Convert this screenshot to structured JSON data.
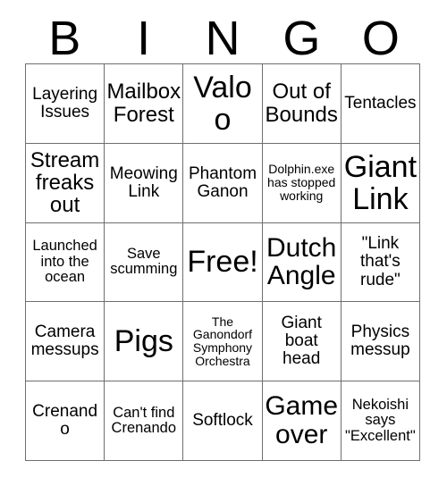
{
  "card": {
    "header_letters": [
      "B",
      "I",
      "N",
      "G",
      "O"
    ],
    "columns": 5,
    "rows": 5,
    "border_color": "#6e6e6e",
    "background_color": "#ffffff",
    "text_color": "#000000",
    "cells": [
      {
        "text": "Layering Issues",
        "size": "md",
        "free": false
      },
      {
        "text": "Mailbox Forest",
        "size": "lg",
        "free": false
      },
      {
        "text": "Valoo",
        "size": "xxl",
        "free": false
      },
      {
        "text": "Out of Bounds",
        "size": "lg",
        "free": false
      },
      {
        "text": "Tentacles",
        "size": "md",
        "free": false
      },
      {
        "text": "Stream freaks out",
        "size": "lg",
        "free": false
      },
      {
        "text": "Meowing Link",
        "size": "md",
        "free": false
      },
      {
        "text": "Phantom Ganon",
        "size": "md",
        "free": false
      },
      {
        "text": "Dolphin.exe has stopped working",
        "size": "xs",
        "free": false
      },
      {
        "text": "Giant Link",
        "size": "xxl",
        "free": false
      },
      {
        "text": "Launched into the ocean",
        "size": "sm",
        "free": false
      },
      {
        "text": "Save scumming",
        "size": "sm",
        "free": false
      },
      {
        "text": "Free!",
        "size": "xxl",
        "free": true
      },
      {
        "text": "Dutch Angle",
        "size": "xl",
        "free": false
      },
      {
        "text": "\"Link that's rude\"",
        "size": "md",
        "free": false
      },
      {
        "text": "Camera messups",
        "size": "md",
        "free": false
      },
      {
        "text": "Pigs",
        "size": "xxl",
        "free": false
      },
      {
        "text": "The Ganondorf Symphony Orchestra",
        "size": "xs",
        "free": false
      },
      {
        "text": "Giant boat head",
        "size": "md",
        "free": false
      },
      {
        "text": "Physics messup",
        "size": "md",
        "free": false
      },
      {
        "text": "Crenando",
        "size": "md",
        "free": false
      },
      {
        "text": "Can't find Crenando",
        "size": "sm",
        "free": false
      },
      {
        "text": "Softlock",
        "size": "md",
        "free": false
      },
      {
        "text": "Game over",
        "size": "xl",
        "free": false
      },
      {
        "text": "Nekoishi says \"Excellent\"",
        "size": "sm",
        "free": false
      }
    ]
  }
}
